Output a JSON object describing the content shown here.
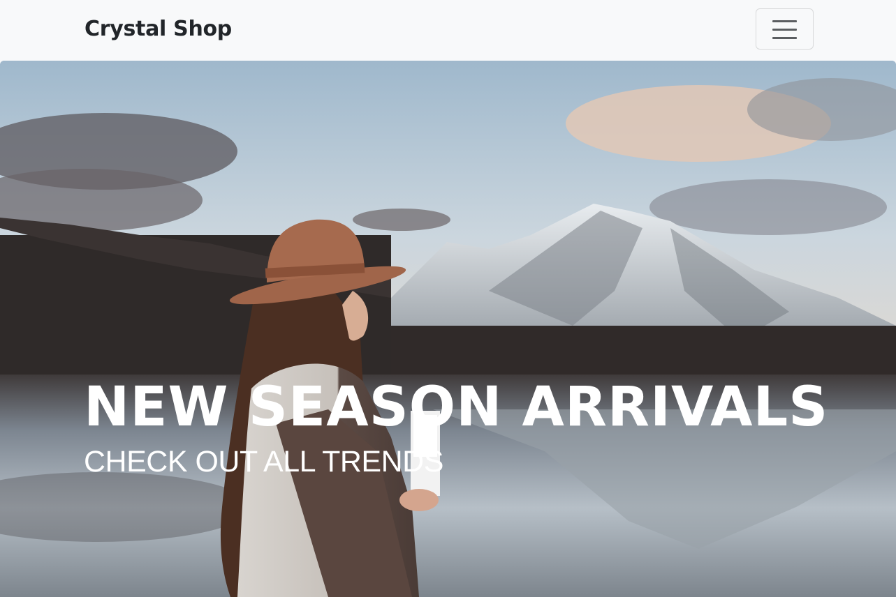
{
  "navbar": {
    "brand": "Crystal Shop",
    "toggler_icon": "hamburger-menu-icon"
  },
  "hero": {
    "title": "NEW SEASON ARRIVALS",
    "subtitle": "CHECK OUT ALL TRENDS",
    "image": "woman-in-hat-by-mountain-lake-photo"
  }
}
